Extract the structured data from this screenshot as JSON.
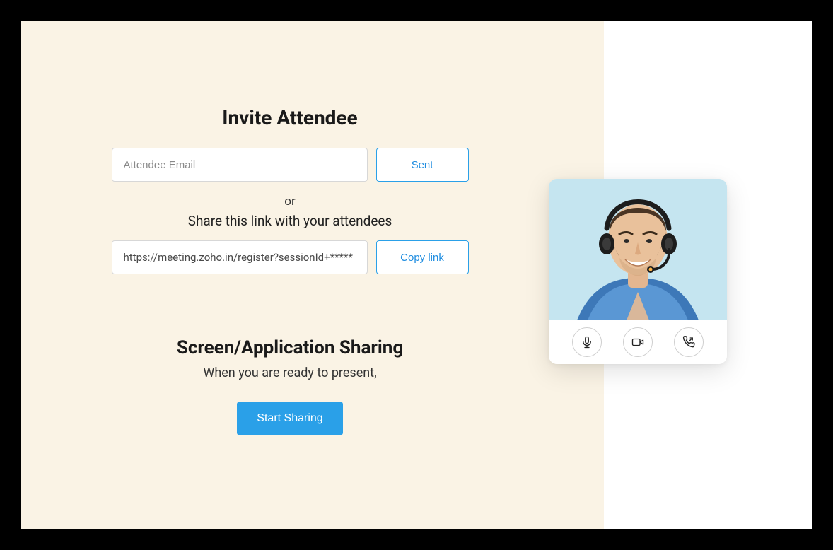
{
  "invite": {
    "title": "Invite Attendee",
    "email_placeholder": "Attendee Email",
    "sent_label": "Sent",
    "or_label": "or",
    "share_text": "Share this link with your attendees",
    "link_value": "https://meeting.zoho.in/register?sessionId+*****",
    "copy_label": "Copy link"
  },
  "sharing": {
    "title": "Screen/Application Sharing",
    "subtitle": "When you are ready to present,",
    "start_label": "Start Sharing"
  },
  "video": {
    "controls": {
      "mic": "microphone-icon",
      "camera": "camera-icon",
      "phone": "phone-icon"
    }
  }
}
